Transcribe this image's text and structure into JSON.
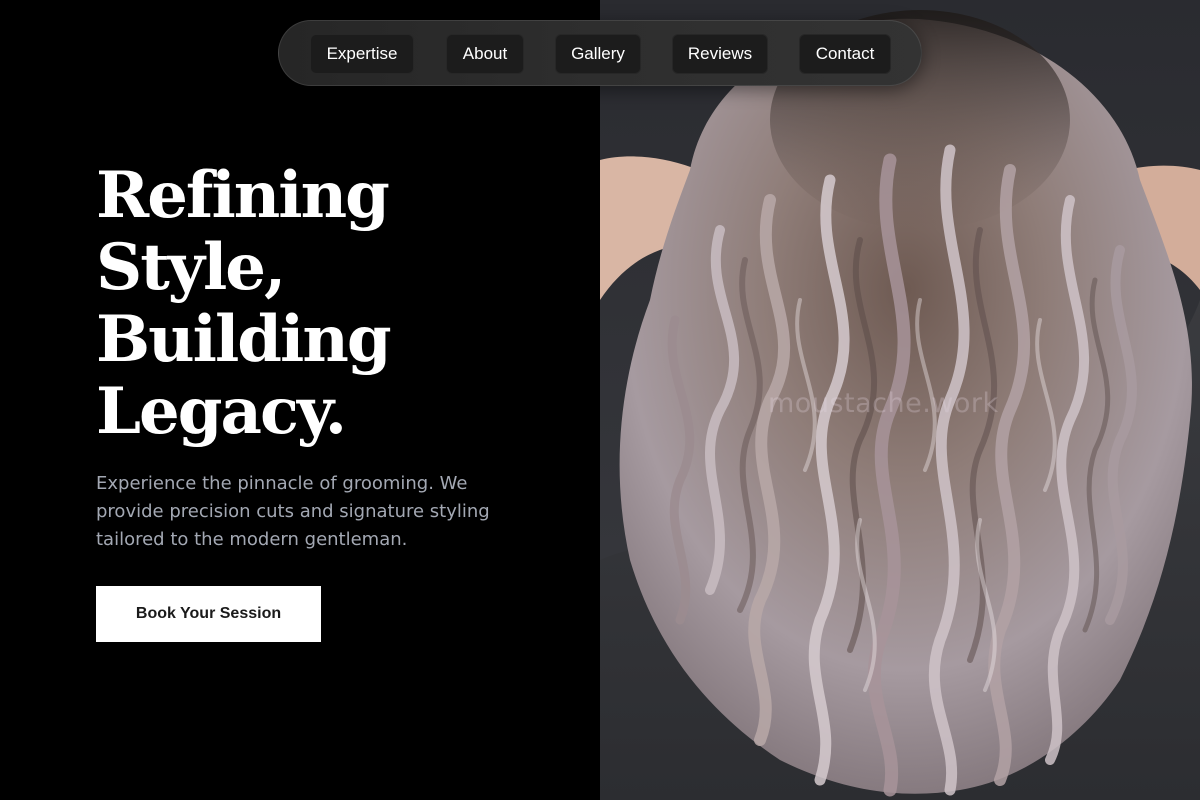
{
  "nav": {
    "items": [
      {
        "label": "Expertise"
      },
      {
        "label": "About"
      },
      {
        "label": "Gallery"
      },
      {
        "label": "Reviews"
      },
      {
        "label": "Contact"
      }
    ]
  },
  "hero": {
    "title_lines": [
      "Refining",
      "Style,",
      "Building",
      "Legacy."
    ],
    "subtitle": "Experience the pinnacle of grooming. We provide precision cuts and signature styling tailored to the modern gentleman.",
    "cta_label": "Book Your Session"
  },
  "photo": {
    "watermark": "moustache.work",
    "subject": "curly-hair-photo"
  },
  "colors": {
    "background": "#000000",
    "title": "#ffffff",
    "subtitle": "#a3a8b3",
    "button_bg": "#ffffff",
    "button_text": "#1a1a1a",
    "nav_bg": "#2b2b2b",
    "nav_item_bg": "#1c1c1c"
  }
}
